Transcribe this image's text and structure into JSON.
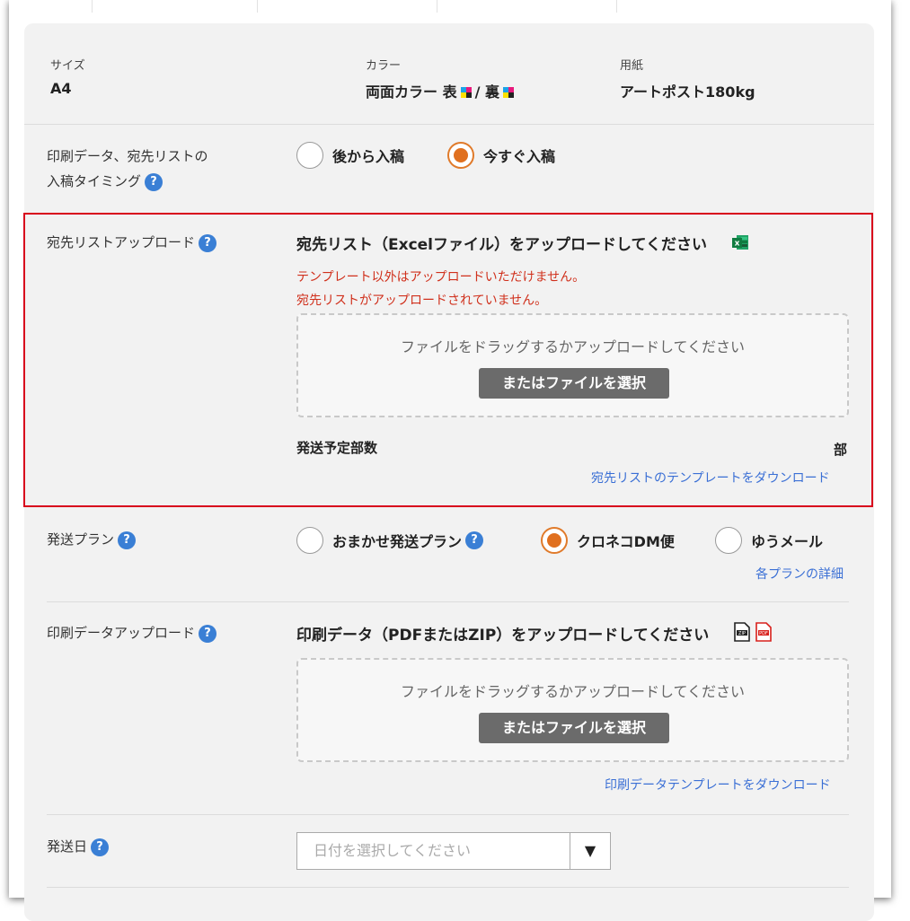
{
  "spec": {
    "size": {
      "label": "サイズ",
      "value": "A4"
    },
    "color": {
      "label": "カラー",
      "value_prefix": "両面カラー 表",
      "value_mid": "/ 裏"
    },
    "paper": {
      "label": "用紙",
      "value": "アートポスト180kg"
    }
  },
  "timing": {
    "label_line1": "印刷データ、宛先リストの",
    "label_line2": "入稿タイミング",
    "options": [
      "後から入稿",
      "今すぐ入稿"
    ],
    "selected": "今すぐ入稿"
  },
  "address_upload": {
    "label": "宛先リストアップロード",
    "heading": "宛先リスト（Excelファイル）をアップロードしてください",
    "errors": [
      "テンプレート以外はアップロードいただけません。",
      "宛先リストがアップロードされていません。"
    ],
    "dropzone_text": "ファイルをドラッグするかアップロードしてください",
    "button": "またはファイルを選択",
    "count_label": "発送予定部数",
    "count_unit": "部",
    "template_link": "宛先リストのテンプレートをダウンロード"
  },
  "plan": {
    "label": "発送プラン",
    "options": [
      "おまかせ発送プラン",
      "クロネコDM便",
      "ゆうメール"
    ],
    "selected": "クロネコDM便",
    "details_link": "各プランの詳細"
  },
  "print_upload": {
    "label": "印刷データアップロード",
    "heading": "印刷データ（PDFまたはZIP）をアップロードしてください",
    "dropzone_text": "ファイルをドラッグするかアップロードしてください",
    "button": "またはファイルを選択",
    "template_link": "印刷データテンプレートをダウンロード"
  },
  "ship_date": {
    "label": "発送日",
    "placeholder": "日付を選択してください",
    "arrow": "▼"
  },
  "help_glyph": "?",
  "colors": {
    "accent_orange": "#e0701f",
    "error_red": "#d0301c",
    "link_blue": "#3a6fd5",
    "highlight_red": "#d8001c"
  }
}
